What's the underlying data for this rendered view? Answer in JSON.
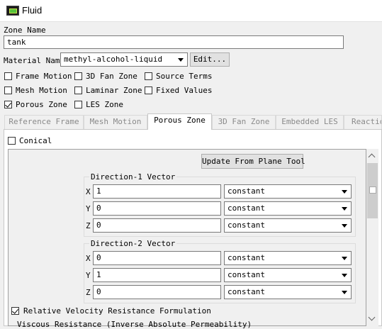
{
  "window": {
    "title": "Fluid"
  },
  "zone_name": {
    "label": "Zone Name",
    "value": "tank"
  },
  "material": {
    "label": "Material Name",
    "selected": "methyl-alcohol-liquid",
    "edit_label": "Edit..."
  },
  "checks": {
    "frame_motion": {
      "label": "Frame Motion",
      "checked": false
    },
    "fan_zone_3d": {
      "label": "3D Fan Zone",
      "checked": false
    },
    "source_terms": {
      "label": "Source Terms",
      "checked": false
    },
    "mesh_motion": {
      "label": "Mesh Motion",
      "checked": false
    },
    "laminar_zone": {
      "label": "Laminar Zone",
      "checked": false
    },
    "fixed_values": {
      "label": "Fixed Values",
      "checked": false
    },
    "porous_zone": {
      "label": "Porous Zone",
      "checked": true
    },
    "les_zone": {
      "label": "LES Zone",
      "checked": false
    }
  },
  "tabs": [
    {
      "label": "Reference Frame",
      "active": false
    },
    {
      "label": "Mesh Motion",
      "active": false
    },
    {
      "label": "Porous Zone",
      "active": true
    },
    {
      "label": "3D Fan Zone",
      "active": false
    },
    {
      "label": "Embedded LES",
      "active": false
    },
    {
      "label": "Reactio",
      "active": false
    }
  ],
  "porous": {
    "conical": {
      "label": "Conical",
      "checked": false
    },
    "update_button": "Update From Plane Tool",
    "direction1": {
      "title": "Direction-1 Vector",
      "rows": [
        {
          "axis": "X",
          "value": "1",
          "method": "constant"
        },
        {
          "axis": "Y",
          "value": "0",
          "method": "constant"
        },
        {
          "axis": "Z",
          "value": "0",
          "method": "constant"
        }
      ]
    },
    "direction2": {
      "title": "Direction-2 Vector",
      "rows": [
        {
          "axis": "X",
          "value": "0",
          "method": "constant"
        },
        {
          "axis": "Y",
          "value": "1",
          "method": "constant"
        },
        {
          "axis": "Z",
          "value": "0",
          "method": "constant"
        }
      ]
    },
    "relative_velocity": {
      "label": "Relative Velocity Resistance Formulation",
      "checked": true
    },
    "viscous_partial": "Viscous Resistance (Inverse Absolute Permeability)"
  }
}
